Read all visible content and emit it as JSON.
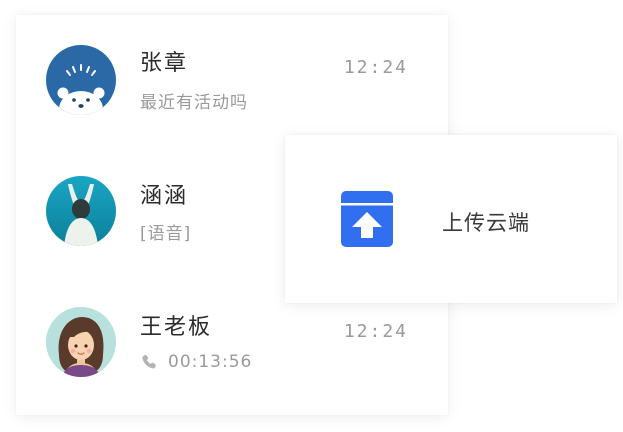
{
  "chat_list": [
    {
      "name": "张章",
      "preview": "最近有活动吗",
      "time": "12:24",
      "avatar": "polar-bear-avatar"
    },
    {
      "name": "涵涵",
      "preview": "[语音]",
      "time": "",
      "avatar": "girl-photo-avatar"
    },
    {
      "name": "王老板",
      "preview": "00:13:56",
      "time": "12:24",
      "avatar": "cartoon-woman-avatar",
      "preview_icon": "phone-icon"
    }
  ],
  "popup": {
    "label": "上传云端",
    "icon": "cloud-upload-box-icon"
  },
  "colors": {
    "accent_blue": "#2f6ff0",
    "text_primary": "#2b2b2b",
    "text_secondary": "#9a9a9a"
  }
}
